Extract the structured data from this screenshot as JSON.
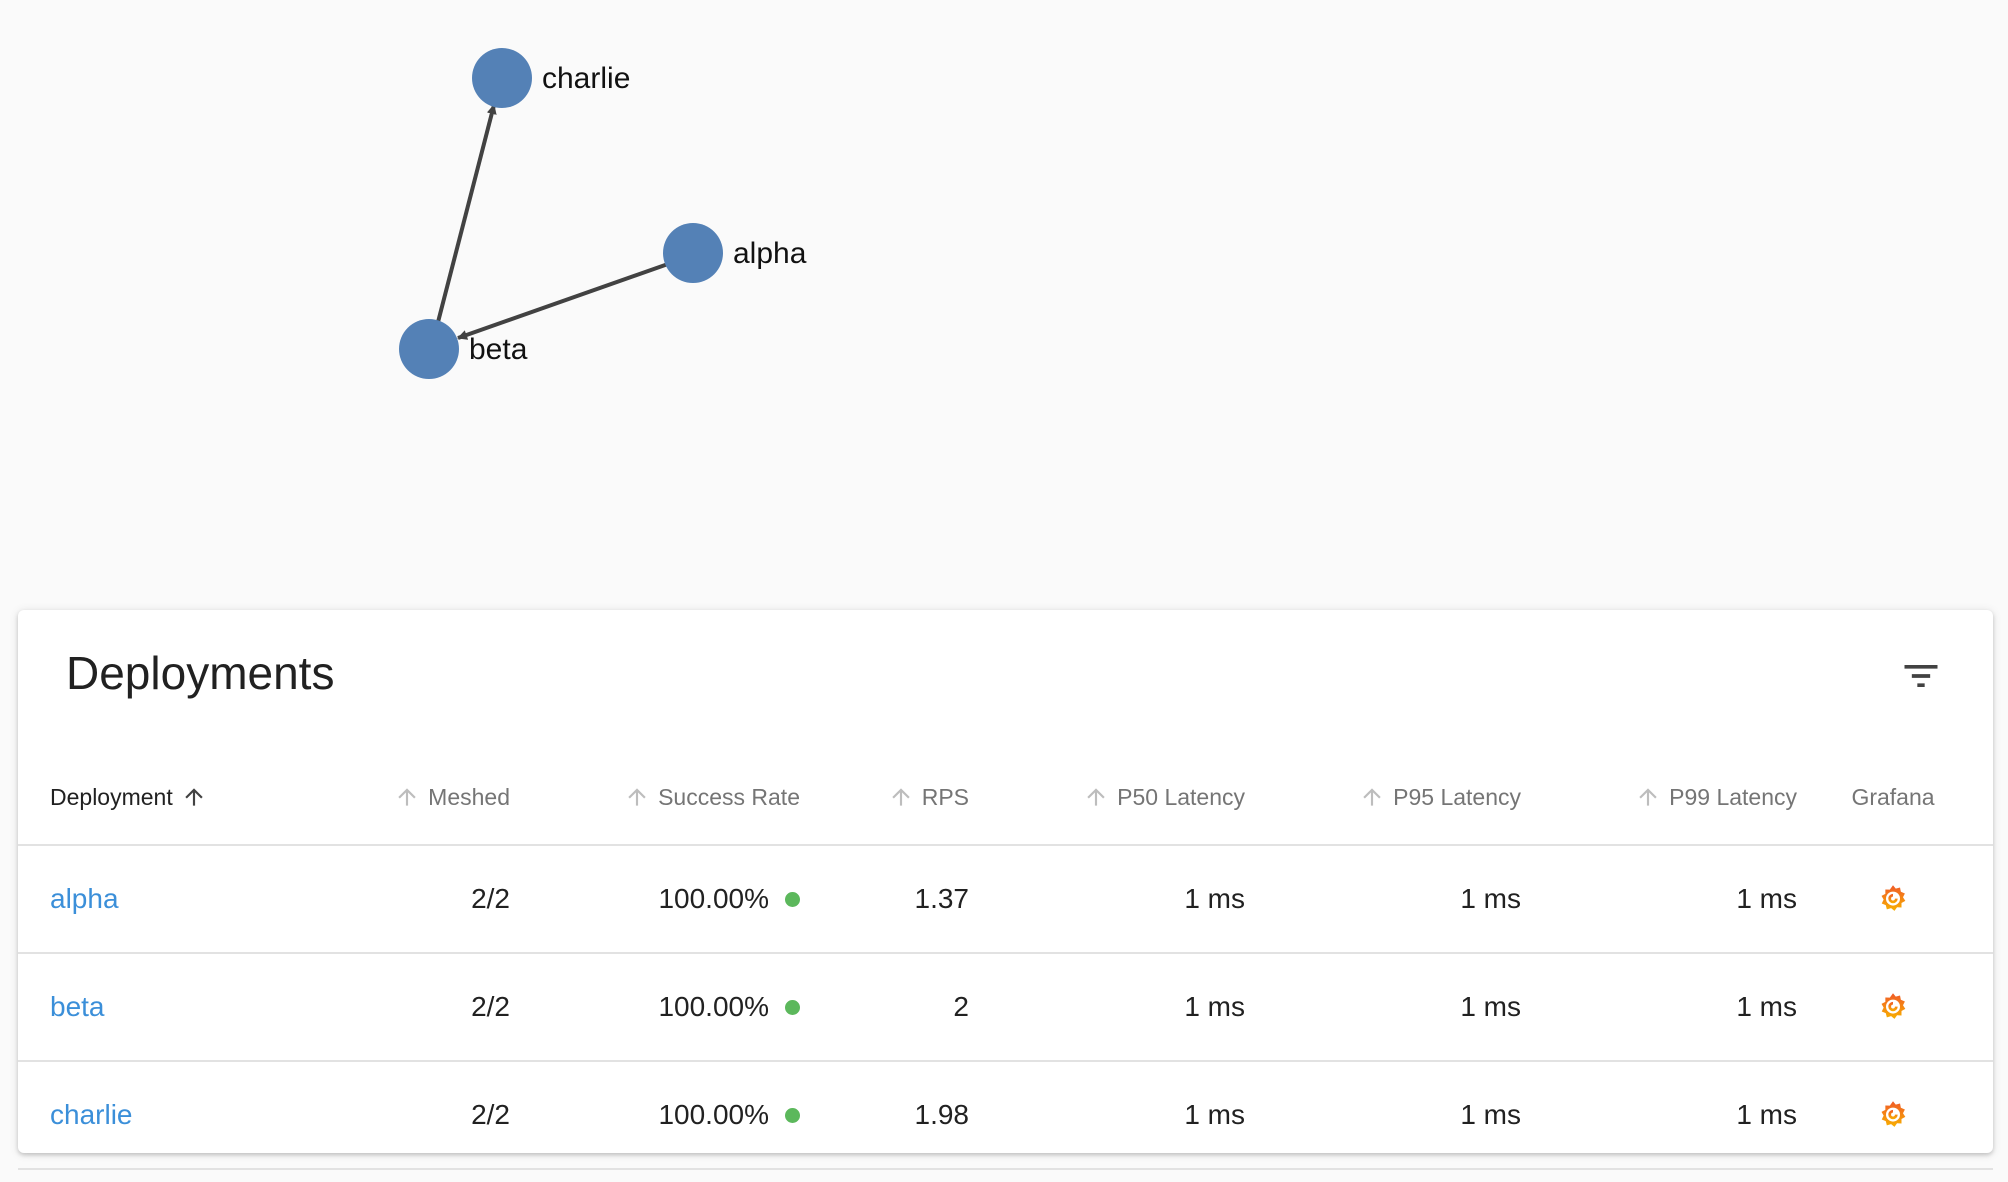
{
  "graph": {
    "nodes": [
      {
        "id": "charlie",
        "label": "charlie"
      },
      {
        "id": "alpha",
        "label": "alpha"
      },
      {
        "id": "beta",
        "label": "beta"
      }
    ],
    "edges": [
      {
        "from": "alpha",
        "to": "beta"
      },
      {
        "from": "beta",
        "to": "charlie"
      }
    ],
    "node_color": "#5481b6",
    "edge_color": "#424242"
  },
  "card": {
    "title": "Deployments",
    "filter_icon": "filter-list-icon"
  },
  "table": {
    "columns": [
      {
        "key": "deployment",
        "label": "Deployment",
        "sorted": true
      },
      {
        "key": "meshed",
        "label": "Meshed",
        "sorted": false
      },
      {
        "key": "success_rate",
        "label": "Success Rate",
        "sorted": false
      },
      {
        "key": "rps",
        "label": "RPS",
        "sorted": false
      },
      {
        "key": "p50",
        "label": "P50 Latency",
        "sorted": false
      },
      {
        "key": "p95",
        "label": "P95 Latency",
        "sorted": false
      },
      {
        "key": "p99",
        "label": "P99 Latency",
        "sorted": false
      },
      {
        "key": "grafana",
        "label": "Grafana",
        "sorted": false
      }
    ],
    "rows": [
      {
        "deployment": "alpha",
        "meshed": "2/2",
        "success_rate": "100.00%",
        "status": "green",
        "rps": "1.37",
        "p50": "1 ms",
        "p95": "1 ms",
        "p99": "1 ms",
        "grafana_icon": "grafana-icon"
      },
      {
        "deployment": "beta",
        "meshed": "2/2",
        "success_rate": "100.00%",
        "status": "green",
        "rps": "2",
        "p50": "1 ms",
        "p95": "1 ms",
        "p99": "1 ms",
        "grafana_icon": "grafana-icon"
      },
      {
        "deployment": "charlie",
        "meshed": "2/2",
        "success_rate": "100.00%",
        "status": "green",
        "rps": "1.98",
        "p50": "1 ms",
        "p95": "1 ms",
        "p99": "1 ms",
        "grafana_icon": "grafana-icon"
      }
    ]
  },
  "colors": {
    "link": "#3b8fd9",
    "status_green": "#5cb85c",
    "grafana_orange": "#f46800",
    "grafana_yellow": "#f8b000"
  }
}
